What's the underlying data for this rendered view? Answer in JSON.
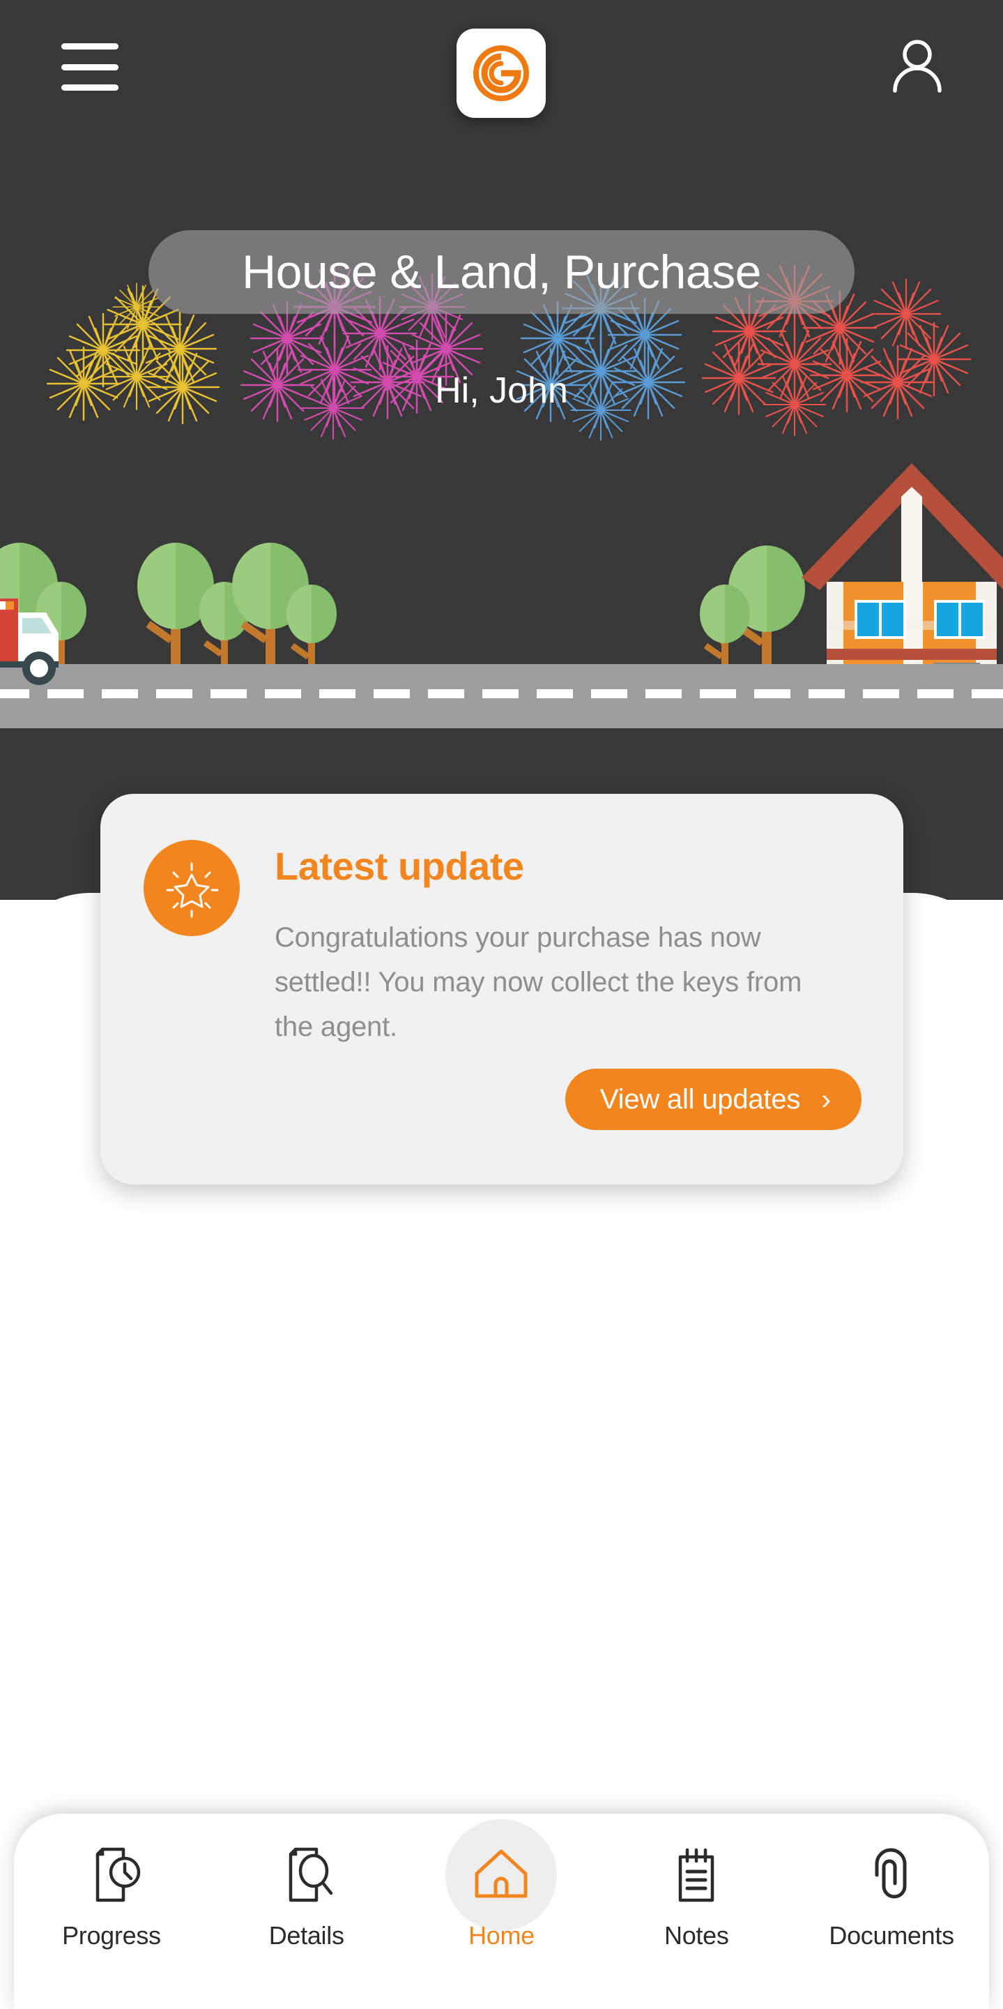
{
  "app": {
    "brand_letter": "G",
    "accent_color": "#F2851E",
    "dark_bg": "#383838"
  },
  "topbar": {
    "menu_icon": "hamburger-menu-icon",
    "logo_icon": "brand-logo-icon",
    "profile_icon": "user-account-icon"
  },
  "hero": {
    "title": "House & Land, Purchase",
    "greeting": "Hi, John",
    "scene_icons": [
      "moving-truck-icon",
      "tree-icon",
      "house-icon",
      "road-icon"
    ],
    "firework_colors": [
      "#E8C233",
      "#D44BB0",
      "#5B9BD5",
      "#E8524A"
    ]
  },
  "update_card": {
    "badge_icon": "sparkle-star-icon",
    "title": "Latest update",
    "body": "Congratulations your purchase has now settled!! You may now collect the keys from the agent.",
    "cta_label": "View all updates",
    "cta_chevron": "›"
  },
  "bottom_nav": {
    "items": [
      {
        "label": "Progress",
        "icon": "document-clock-icon",
        "active": false
      },
      {
        "label": "Details",
        "icon": "document-search-icon",
        "active": false
      },
      {
        "label": "Home",
        "icon": "house-outline-icon",
        "active": true
      },
      {
        "label": "Notes",
        "icon": "notepad-icon",
        "active": false
      },
      {
        "label": "Documents",
        "icon": "paperclip-icon",
        "active": false
      }
    ]
  }
}
